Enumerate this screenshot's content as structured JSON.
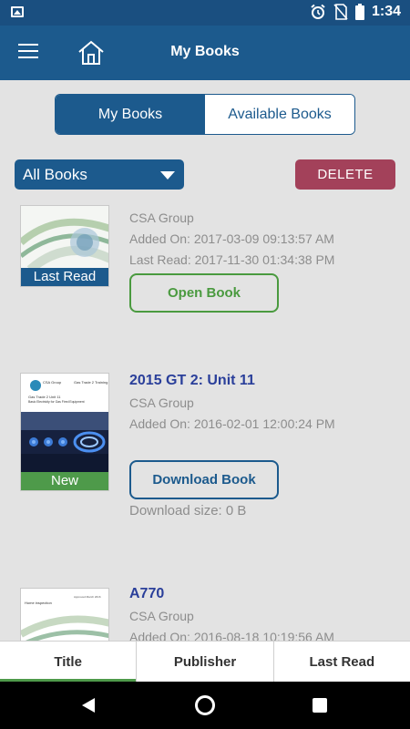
{
  "status_bar": {
    "time": "1:34"
  },
  "app_bar": {
    "title": "My Books"
  },
  "segments": [
    {
      "label": "My Books",
      "active": true
    },
    {
      "label": "Available Books",
      "active": false
    }
  ],
  "filter": {
    "selected": "All Books"
  },
  "delete_label": "DELETE",
  "books": [
    {
      "title": "",
      "publisher": "CSA Group",
      "added": "Added On: 2017-03-09 09:13:57 AM",
      "last_read": "Last Read: 2017-11-30 01:34:38 PM",
      "badge": "Last Read",
      "action": "Open Book"
    },
    {
      "title": "2015 GT 2: Unit 11",
      "publisher": "CSA Group",
      "added": "Added On: 2016-02-01 12:00:24 PM",
      "badge": "New",
      "action": "Download Book",
      "download_size": "Download size: 0 B",
      "cover_text": {
        "brand": "CSA Group",
        "series": "Gas Trade 2 Training",
        "unit": "Gas Trade 2 Unit 11",
        "subtitle": "Basic Electricity for Gas Fired Equipment"
      }
    },
    {
      "title": "A770",
      "publisher": "CSA Group",
      "added": "Added On: 2016-08-18 10:19:56 AM",
      "cover_text": {
        "heading": "Home inspection",
        "note": "Approved March 2016"
      }
    }
  ],
  "sort_tabs": [
    {
      "label": "Title",
      "active": true
    },
    {
      "label": "Publisher",
      "active": false
    },
    {
      "label": "Last Read",
      "active": false
    }
  ],
  "colors": {
    "primary": "#1c5a8d",
    "delete": "#a3415a",
    "open_button": "#4a9a3f",
    "new_badge": "#4e9a4a",
    "title_text": "#2a3f9a"
  }
}
